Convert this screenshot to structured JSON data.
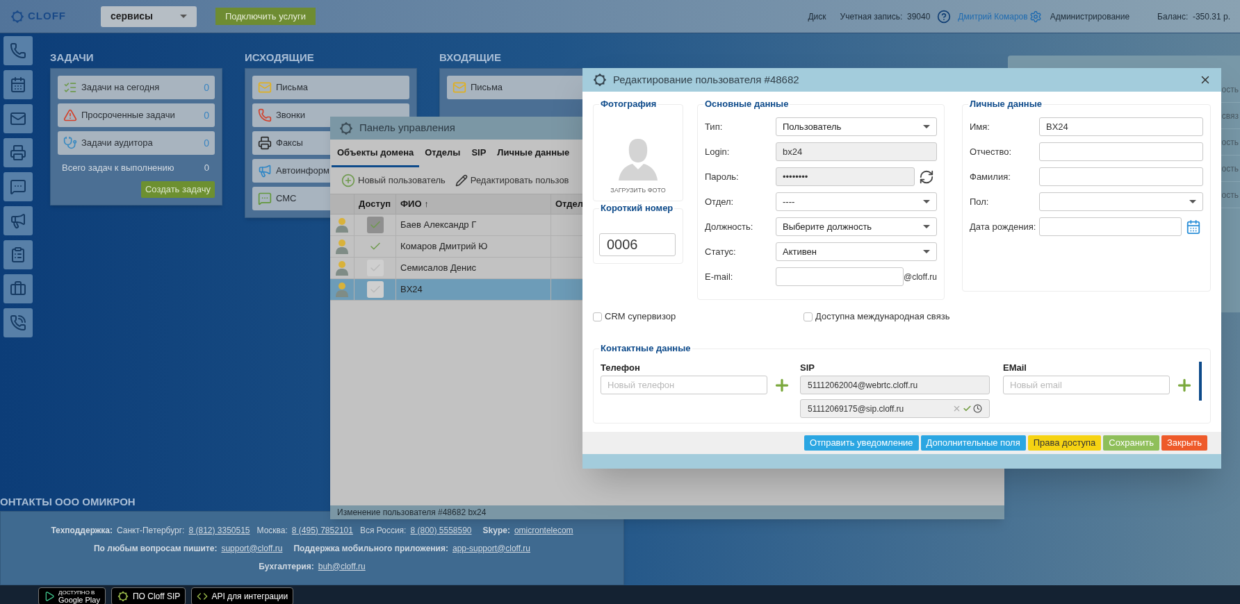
{
  "top_bar": {
    "logo": "CLOFF",
    "service_select": "сервисы",
    "connect_button": "Подключить услуги",
    "disk": "Диск",
    "account": "Учетная запись:  39040",
    "user": "Дмитрий Комаров",
    "admin": "Администрирование",
    "balance": "Баланс:  -350.31 р."
  },
  "widgets": [
    {
      "title": "ЗАДАЧИ",
      "items": [
        {
          "kind": "tasks",
          "label": "Задачи на сегодня",
          "count": "0"
        },
        {
          "kind": "overdue",
          "label": "Просроченные задачи",
          "count": "0"
        },
        {
          "kind": "auditor",
          "label": "Задачи аудитора",
          "count": "0"
        }
      ],
      "total": {
        "label": "Всего задач к выполнению",
        "count": "0"
      },
      "button": "Создать задачу"
    },
    {
      "title": "ИСХОДЯЩИЕ",
      "items": [
        {
          "kind": "mail",
          "label": "Письма"
        },
        {
          "kind": "call",
          "label": "Звонки"
        },
        {
          "kind": "fax",
          "label": "Факсы"
        },
        {
          "kind": "autoinform",
          "label": "Автоинформ"
        },
        {
          "kind": "sms",
          "label": "СМС"
        }
      ]
    },
    {
      "title": "ВХОДЯЩИЕ",
      "items": [
        {
          "kind": "mail",
          "label": "Письма"
        }
      ]
    }
  ],
  "side_panel": {
    "rows": [
      "ость",
      "связ",
      "ость",
      "ость",
      "ость"
    ]
  },
  "control_panel": {
    "title": "Панель управления",
    "tabs": [
      {
        "label": "Объекты домена",
        "selected": true
      },
      {
        "label": "Отделы",
        "selected": false
      },
      {
        "label": "SIP",
        "selected": false
      },
      {
        "label": "Личные данные",
        "selected": false
      }
    ],
    "toolbar": [
      {
        "kind": "add",
        "label": "Новый пользователь"
      },
      {
        "kind": "edit",
        "label": "Редактировать пользов"
      }
    ],
    "columns": [
      "Доступ",
      "ФИО ↑",
      "Отдел"
    ],
    "rows": [
      {
        "access": {
          "checked": true,
          "boxed": true
        },
        "name": "Баев Александр Г",
        "selected": false
      },
      {
        "access": {
          "checked": true,
          "boxed": false
        },
        "name": "Комаров Дмитрий Ю",
        "selected": false
      },
      {
        "access": {
          "checked": false,
          "boxed": true
        },
        "name": "Семисалов Денис",
        "selected": false
      },
      {
        "access": {
          "checked": false,
          "boxed": true
        },
        "name": "BX24",
        "selected": true
      }
    ],
    "status": "Изменение пользователя #48682 bx24"
  },
  "dialog": {
    "title": "Редактирование пользователя #48682",
    "photo": {
      "heading": "Фотография",
      "upload": "ЗАГРУЗИТЬ ФОТО"
    },
    "short_number": {
      "heading": "Короткий номер",
      "value": "0006"
    },
    "main": {
      "heading": "Основные данные",
      "fields": [
        {
          "kind": "select",
          "label": "Тип:",
          "value": "Пользователь"
        },
        {
          "kind": "readonly",
          "label": "Login:",
          "value": "bx24"
        },
        {
          "kind": "password",
          "label": "Пароль:",
          "value": "••••••••"
        },
        {
          "kind": "select",
          "label": "Отдел:",
          "value": "----"
        },
        {
          "kind": "select",
          "label": "Должность:",
          "value": "Выберите должность"
        },
        {
          "kind": "select",
          "label": "Статус:",
          "value": "Активен"
        },
        {
          "kind": "email",
          "label": "E-mail:",
          "suffix": "@cloff.ru"
        }
      ]
    },
    "personal": {
      "heading": "Личные данные",
      "fields": [
        {
          "kind": "input",
          "label": "Имя:",
          "value": "BX24"
        },
        {
          "kind": "input",
          "label": "Отчество:"
        },
        {
          "kind": "input",
          "label": "Фамилия:"
        },
        {
          "kind": "select",
          "label": "Пол:"
        },
        {
          "kind": "date",
          "label": "Дата рождения:"
        }
      ]
    },
    "options": [
      {
        "label": "CRM супервизор",
        "checked": false
      },
      {
        "label": "Доступна международная связь",
        "checked": false
      }
    ],
    "contacts": {
      "heading": "Контактные данные",
      "phone": {
        "heading": "Телефон",
        "placeholder": "Новый телефон"
      },
      "sip": {
        "heading": "SIP",
        "entries": [
          {
            "value": "51112062004@webrtc.cloff.ru",
            "actions": false
          },
          {
            "value": "51112069175@sip.cloff.ru",
            "actions": true
          }
        ]
      },
      "email": {
        "heading": "EMail",
        "placeholder": "Новый email"
      }
    },
    "buttons": [
      {
        "label": "Отправить уведомление",
        "color": "#2ba6e2"
      },
      {
        "label": "Дополнительные поля",
        "color": "#2ba6e2"
      },
      {
        "label": "Права доступа",
        "color": "#f6d312"
      },
      {
        "label": "Сохранить",
        "color": "#8fbf5a"
      },
      {
        "label": "Закрыть",
        "color": "#ee5a2a"
      }
    ]
  },
  "footer": {
    "heading": "ОНТАКТЫ ООО ОМИКРОН",
    "lines": [
      [
        {
          "kind": "label",
          "text": "Техподдержка:"
        },
        {
          "kind": "text",
          "text": "Санкт-Петербург:"
        },
        {
          "kind": "link",
          "text": "8 (812) 3350515"
        },
        {
          "kind": "text",
          "text": "Москва:"
        },
        {
          "kind": "link",
          "text": "8 (495) 7852101"
        },
        {
          "kind": "text",
          "text": "Вся Россия:"
        },
        {
          "kind": "link",
          "text": "8 (800) 5558590"
        },
        {
          "kind": "label",
          "text": "Skype:"
        },
        {
          "kind": "link",
          "text": "omicrontelecom"
        }
      ],
      [
        {
          "kind": "label",
          "text": "По любым вопросам пишите:"
        },
        {
          "kind": "link",
          "text": "support@cloff.ru"
        },
        {
          "kind": "label",
          "text": "Поддержка мобильного приложения:"
        },
        {
          "kind": "link",
          "text": "app-support@cloff.ru"
        }
      ],
      [
        {
          "kind": "label",
          "text": "Бухгалтерия:"
        },
        {
          "kind": "link",
          "text": "buh@cloff.ru"
        }
      ]
    ]
  },
  "app_badges": [
    {
      "kind": "google_play",
      "small": "ДОСТУПНО В",
      "label": "Google Play"
    },
    {
      "kind": "sip",
      "label": "ПО Cloff SIP"
    },
    {
      "kind": "api",
      "label": "API для интеграции"
    }
  ]
}
